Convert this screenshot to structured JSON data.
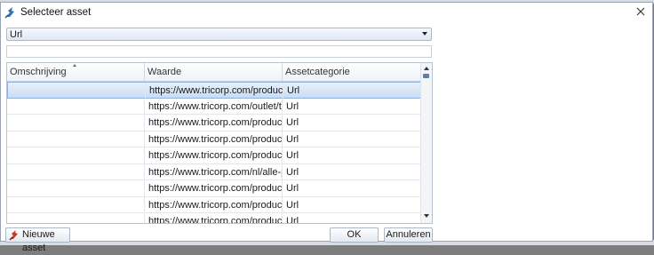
{
  "window": {
    "title": "Selecteer asset",
    "close_icon": "close-icon",
    "app_icon": "asset-picker-icon"
  },
  "filter": {
    "type_value": "Url",
    "search_value": ""
  },
  "grid": {
    "columns": [
      "Omschrijving",
      "Waarde",
      "Assetcategorie"
    ],
    "sorted_column": "Omschrijving",
    "rows": [
      {
        "description": "",
        "value": "https://www.tricorp.com/product/polo",
        "category": "Url",
        "selected": true
      },
      {
        "description": "",
        "value": "https://www.tricorp.com/outlet/t-shirt",
        "category": "Url"
      },
      {
        "description": "",
        "value": "https://www.tricorp.com/product/swea",
        "category": "Url"
      },
      {
        "description": "",
        "value": "https://www.tricorp.com/product/rege",
        "category": "Url"
      },
      {
        "description": "",
        "value": "https://www.tricorp.com/product/polo",
        "category": "Url"
      },
      {
        "description": "",
        "value": "https://www.tricorp.com/nl/alle-produ",
        "category": "Url"
      },
      {
        "description": "",
        "value": "https://www.tricorp.com/product/polo",
        "category": "Url"
      },
      {
        "description": "",
        "value": "https://www.tricorp.com/product/over",
        "category": "Url"
      },
      {
        "description": "",
        "value": "https://www.tricorp.com/product/puff",
        "category": "Url"
      }
    ]
  },
  "buttons": {
    "new_asset": "Nieuwe asset",
    "ok": "OK",
    "cancel": "Annuleren"
  },
  "colors": {
    "selection": "#c9dcf2",
    "scroll_thumb": "#5a7fb3"
  }
}
